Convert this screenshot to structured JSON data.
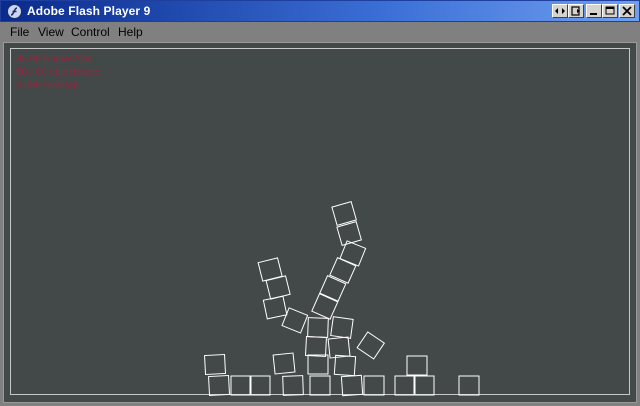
{
  "window": {
    "title": "Adobe Flash Player 9",
    "icon": "flash-player-icon",
    "controls": [
      "restore-down-icon",
      "fullscreen-icon",
      "minimize-icon",
      "maximize-icon",
      "close-icon"
    ]
  },
  "menu": {
    "items": [
      "File",
      "View",
      "Control",
      "Help"
    ]
  },
  "stage": {
    "background": "#434848",
    "box_color": "#ffffff",
    "stats_color": "#8e2a3e",
    "stats": [
      "35.00 frames/sec",
      "50 / 60 objects/sec",
      "0.000 ms/step"
    ]
  }
}
